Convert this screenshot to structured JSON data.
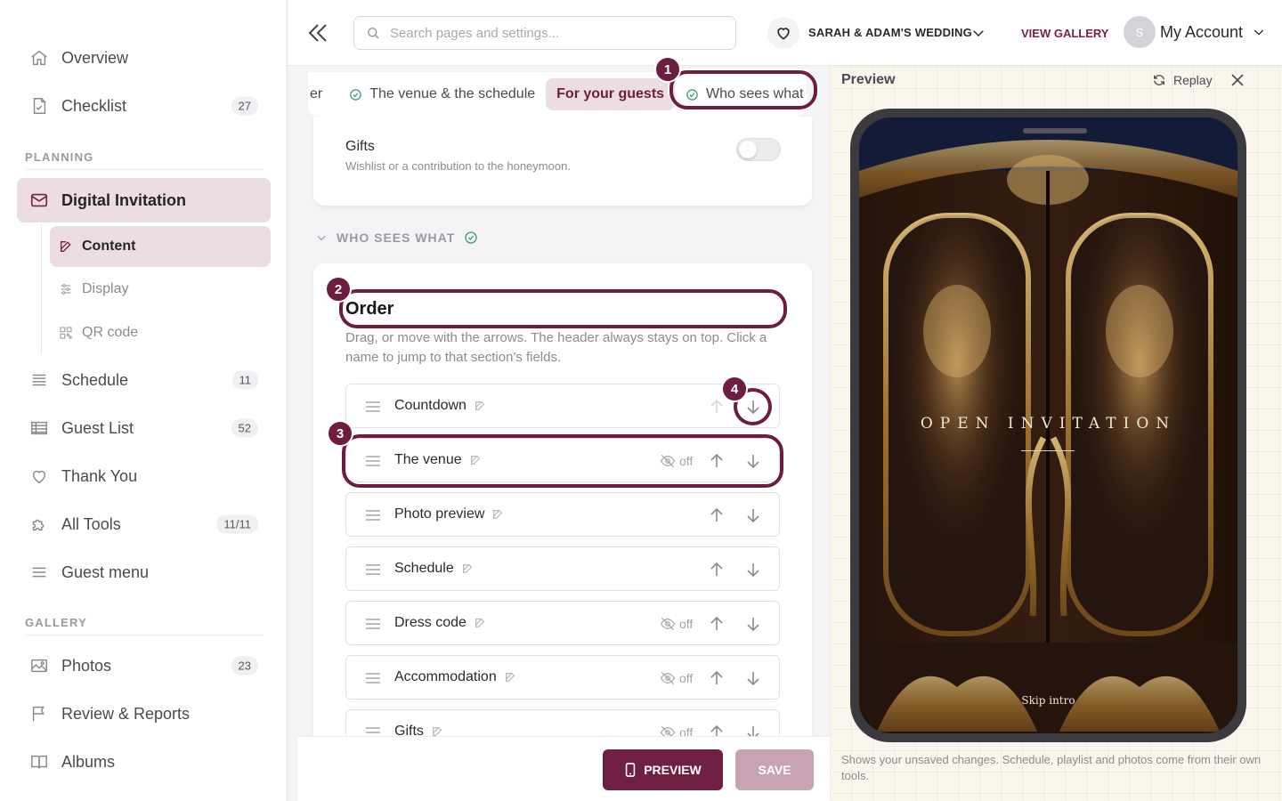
{
  "sidebar": {
    "items": [
      {
        "label": "Overview",
        "icon": "home-icon"
      },
      {
        "label": "Checklist",
        "icon": "checklist-icon",
        "badge": "27"
      },
      {
        "label": "Digital Invitation",
        "icon": "mail-icon",
        "active": true
      },
      {
        "label": "Schedule",
        "icon": "list-icon",
        "badge": "11"
      },
      {
        "label": "Guest List",
        "icon": "table-icon",
        "badge": "52"
      },
      {
        "label": "Thank You",
        "icon": "heart-icon"
      },
      {
        "label": "All Tools",
        "icon": "puzzle-icon",
        "badge": "11/11"
      },
      {
        "label": "Guest menu",
        "icon": "menu-icon"
      },
      {
        "label": "Photos",
        "icon": "image-icon",
        "badge": "23"
      },
      {
        "label": "Review & Reports",
        "icon": "flag-icon"
      },
      {
        "label": "Albums",
        "icon": "book-icon"
      }
    ],
    "sections": {
      "planning": "PLANNING",
      "gallery": "GALLERY"
    },
    "sub_items": [
      {
        "label": "Content",
        "icon": "edit-icon",
        "active": true
      },
      {
        "label": "Display",
        "icon": "sliders-icon"
      },
      {
        "label": "QR code",
        "icon": "qr-icon"
      }
    ]
  },
  "topbar": {
    "search_placeholder": "Search pages and settings...",
    "event_name": "SARAH & ADAM'S WEDDING",
    "view_gallery": "VIEW GALLERY",
    "avatar_initial": "S",
    "account_label": "My Account"
  },
  "editor": {
    "tabs": [
      {
        "label": "er",
        "check": false
      },
      {
        "label": "The venue & the schedule",
        "check": true
      },
      {
        "label": "For your guests",
        "check": false,
        "active": true
      },
      {
        "label": "Who sees what",
        "check": true
      }
    ],
    "gifts": {
      "title": "Gifts",
      "subtitle": "Wishlist or a contribution to the honeymoon.",
      "enabled": false
    },
    "section_title": "WHO SEES WHAT",
    "order": {
      "title": "Order",
      "description": "Drag, or move with the arrows. The header always stays on top. Click a name to jump to that section's fields.",
      "rows": [
        {
          "name": "Countdown",
          "off": false,
          "off_label": ""
        },
        {
          "name": "The venue",
          "off": true,
          "off_label": "off"
        },
        {
          "name": "Photo preview",
          "off": false,
          "off_label": ""
        },
        {
          "name": "Schedule",
          "off": false,
          "off_label": ""
        },
        {
          "name": "Dress code",
          "off": true,
          "off_label": "off"
        },
        {
          "name": "Accommodation",
          "off": true,
          "off_label": "off"
        },
        {
          "name": "Gifts",
          "off": true,
          "off_label": "off"
        }
      ]
    },
    "buttons": {
      "preview": "PREVIEW",
      "save": "SAVE"
    }
  },
  "preview": {
    "title": "Preview",
    "replay": "Replay",
    "open_invitation": "OPEN INVITATION",
    "skip_intro": "Skip intro",
    "note": "Shows your unsaved changes. Schedule, playlist and photos come from their own tools."
  },
  "annotations": [
    "1",
    "2",
    "3",
    "4"
  ],
  "colors": {
    "accent": "#6d1d40",
    "active_bg": "#ecdde2",
    "check_green": "#3f9b6a",
    "save_disabled": "#c8a3b3"
  }
}
